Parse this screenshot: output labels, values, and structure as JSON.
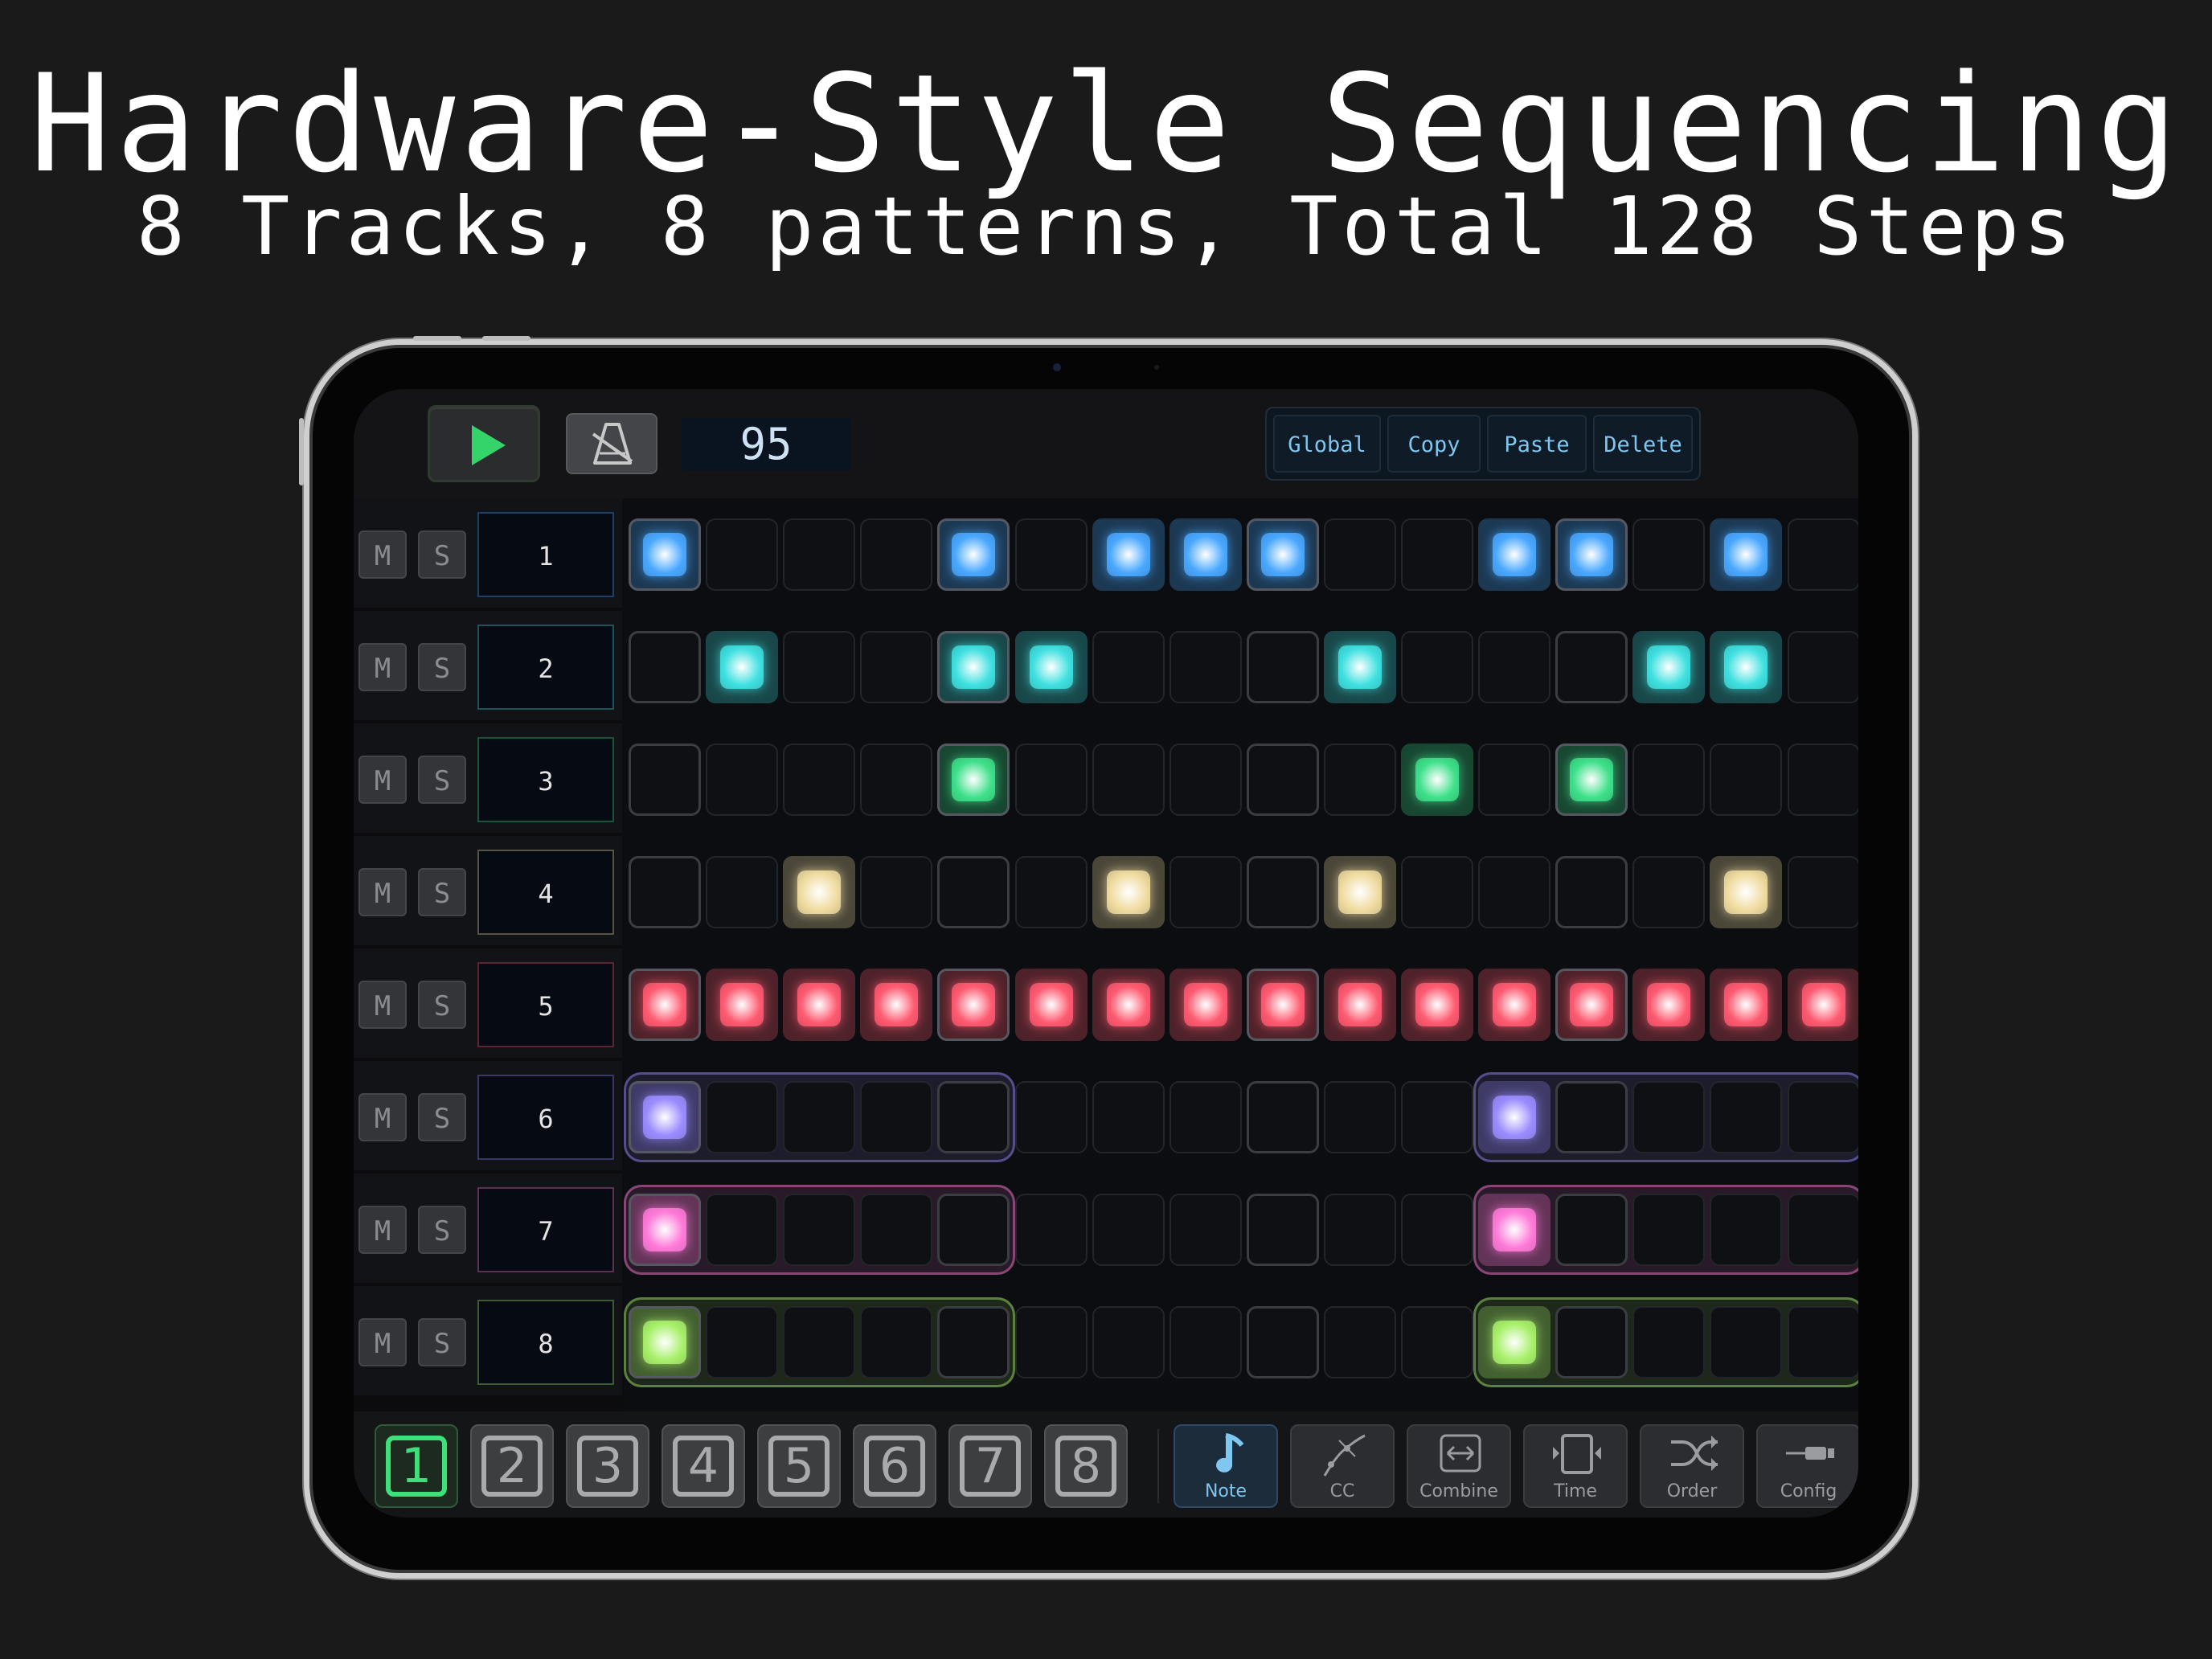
{
  "headline": "Hardware-Style Sequencing",
  "subheadline": "8 Tracks, 8 patterns, Total 128 Steps",
  "toolbar": {
    "play_icon": "play-icon",
    "metronome_icon": "metronome-off-icon",
    "tempo": "95",
    "actions": [
      "Global",
      "Copy",
      "Paste",
      "Delete"
    ]
  },
  "tracks": [
    {
      "label": "1",
      "mute": "M",
      "solo": "S",
      "color": "#4aa8ff",
      "steps": [
        1,
        0,
        0,
        0,
        1,
        0,
        1,
        1,
        1,
        0,
        0,
        1,
        1,
        0,
        1,
        0
      ]
    },
    {
      "label": "2",
      "mute": "M",
      "solo": "S",
      "color": "#3fe0e0",
      "steps": [
        0,
        1,
        0,
        0,
        1,
        1,
        0,
        0,
        0,
        1,
        0,
        0,
        0,
        1,
        1,
        0
      ]
    },
    {
      "label": "3",
      "mute": "M",
      "solo": "S",
      "color": "#3ee08a",
      "steps": [
        0,
        0,
        0,
        0,
        1,
        0,
        0,
        0,
        0,
        0,
        1,
        0,
        1,
        0,
        0,
        0
      ]
    },
    {
      "label": "4",
      "mute": "M",
      "solo": "S",
      "color": "#f0dca0",
      "steps": [
        0,
        0,
        1,
        0,
        0,
        0,
        1,
        0,
        0,
        1,
        0,
        0,
        0,
        0,
        1,
        0
      ]
    },
    {
      "label": "5",
      "mute": "M",
      "solo": "S",
      "color": "#ff5a70",
      "steps": [
        1,
        1,
        1,
        1,
        1,
        1,
        1,
        1,
        1,
        1,
        1,
        1,
        1,
        1,
        1,
        1
      ]
    },
    {
      "label": "6",
      "mute": "M",
      "solo": "S",
      "color": "#9a8cff",
      "steps": [
        1,
        0,
        0,
        0,
        0,
        0,
        0,
        0,
        0,
        0,
        0,
        1,
        0,
        0,
        0,
        0
      ]
    },
    {
      "label": "7",
      "mute": "M",
      "solo": "S",
      "color": "#ff7ad8",
      "steps": [
        1,
        0,
        0,
        0,
        0,
        0,
        0,
        0,
        0,
        0,
        0,
        1,
        0,
        0,
        0,
        0
      ]
    },
    {
      "label": "8",
      "mute": "M",
      "solo": "S",
      "color": "#a8f06a",
      "steps": [
        1,
        0,
        0,
        0,
        0,
        0,
        0,
        0,
        0,
        0,
        0,
        1,
        0,
        0,
        0,
        0
      ]
    }
  ],
  "patterns": [
    "1",
    "2",
    "3",
    "4",
    "5",
    "6",
    "7",
    "8"
  ],
  "active_pattern": "1",
  "modes": [
    {
      "label": "Note",
      "icon": "music-note-icon"
    },
    {
      "label": "CC",
      "icon": "curve-icon"
    },
    {
      "label": "Combine",
      "icon": "combine-arrows-icon"
    },
    {
      "label": "Time",
      "icon": "time-stretch-icon"
    },
    {
      "label": "Order",
      "icon": "shuffle-icon"
    },
    {
      "label": "Config",
      "icon": "cable-icon"
    }
  ],
  "active_mode": "Note"
}
